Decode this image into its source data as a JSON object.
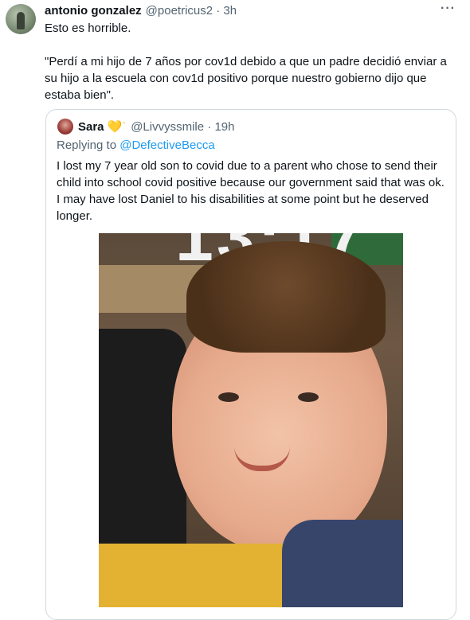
{
  "tweet": {
    "author_name": "antonio gonzalez",
    "author_meta": "@poetricus2 · 3h",
    "more_icon": "···",
    "line1": "Esto es horrible.",
    "line2": "\"Perdí a mi hijo de 7 años por cov1d debido a que un padre decidió enviar a su hijo a la escuela con cov1d positivo porque nuestro gobierno dijo que estaba bien\"."
  },
  "quote": {
    "name": "Sara",
    "heart": "💛`",
    "meta": "@Livvyssmile · 19h",
    "replying_prefix": "Replying to ",
    "replying_handle": "@DefectiveBecca",
    "text": "I lost my 7 year old son to covid due to a parent who chose to send their child into school covid positive because our government said that was ok. I may have lost Daniel to his disabilities at some point but he deserved longer.",
    "photo_clock": "13:17"
  }
}
